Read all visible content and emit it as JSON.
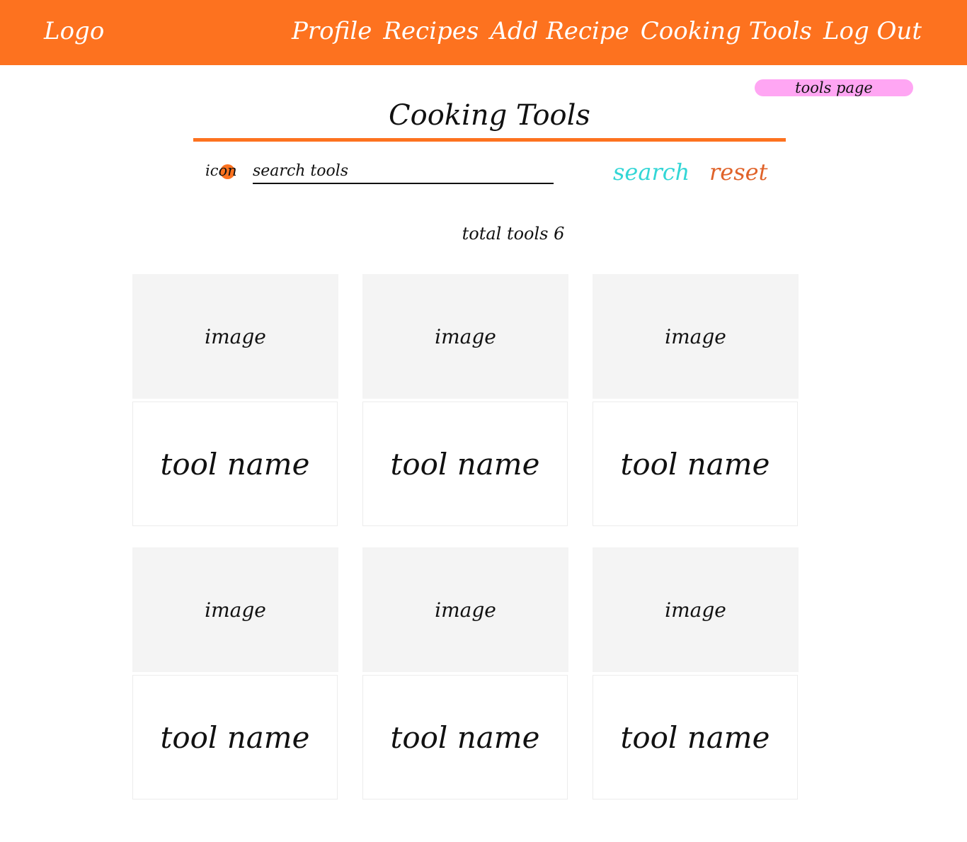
{
  "header": {
    "logo": "Logo",
    "nav": [
      "Profile",
      "Recipes",
      "Add Recipe",
      "Cooking Tools",
      "Log Out"
    ]
  },
  "page_tag": "tools page",
  "title": "Cooking Tools",
  "search": {
    "icon_label": "icon",
    "placeholder": "search tools",
    "search_label": "search",
    "reset_label": "reset"
  },
  "total_label": "total tools 6",
  "tools": [
    {
      "image_label": "image",
      "name": "tool name"
    },
    {
      "image_label": "image",
      "name": "tool name"
    },
    {
      "image_label": "image",
      "name": "tool name"
    },
    {
      "image_label": "image",
      "name": "tool name"
    },
    {
      "image_label": "image",
      "name": "tool name"
    },
    {
      "image_label": "image",
      "name": "tool name"
    }
  ],
  "colors": {
    "brand_orange": "#fd721f",
    "tag_pink": "#ffa6f3",
    "search_teal": "#33d6d6",
    "reset_orange": "#e0632a",
    "image_placeholder": "#f4f4f4"
  }
}
